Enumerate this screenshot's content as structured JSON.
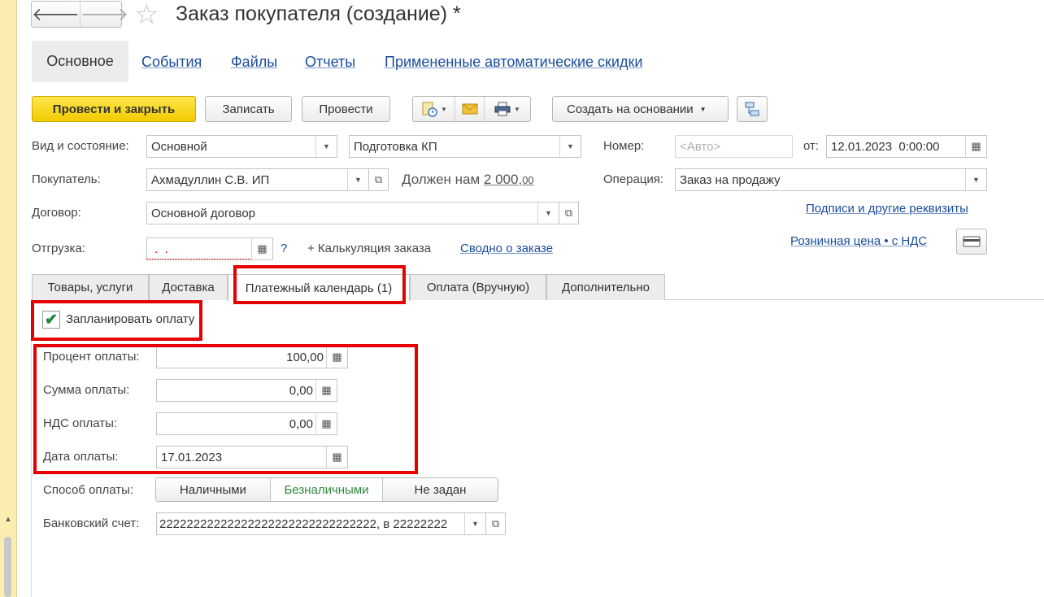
{
  "window": {
    "title": "Заказ покупателя (создание) *"
  },
  "nav": {
    "back": "🡐",
    "forward": "🡒",
    "star": "☆"
  },
  "top_tabs": {
    "main": "Основное",
    "links": [
      "События",
      "Файлы",
      "Отчеты",
      "Примененные автоматические скидки"
    ]
  },
  "toolbar": {
    "post_close": "Провести и закрыть",
    "save": "Записать",
    "post": "Провести",
    "create_based": "Создать на основании"
  },
  "form": {
    "kind_label": "Вид и состояние:",
    "kind_value": "Основной",
    "state_value": "Подготовка КП",
    "number_label": "Номер:",
    "number_placeholder": "<Авто>",
    "from_label": "от:",
    "date_value": "12.01.2023  0:00:00",
    "buyer_label": "Покупатель:",
    "buyer_value": "Ахмадуллин С.В. ИП",
    "owes_label": "Должен нам",
    "owes_amount": "2 000,",
    "owes_cents": "00",
    "operation_label": "Операция:",
    "operation_value": "Заказ на продажу",
    "contract_label": "Договор:",
    "contract_value": "Основной договор",
    "signatures_link": "Подписи и другие реквизиты",
    "shipment_label": "Отгрузка:",
    "shipment_value": " .  .",
    "question": "?",
    "calc_label": "+ Калькуляция заказа",
    "summary_link": "Сводно о заказе",
    "retail_link": "Розничная цена • с НДС"
  },
  "tabs": [
    "Товары, услуги",
    "Доставка",
    "Платежный календарь (1)",
    "Оплата (Вручную)",
    "Дополнительно"
  ],
  "payment": {
    "schedule_label": "Запланировать оплату",
    "schedule_checked": true,
    "percent_label": "Процент оплаты:",
    "percent_value": "100,00",
    "sum_label": "Сумма оплаты:",
    "sum_value": "0,00",
    "vat_label": "НДС оплаты:",
    "vat_value": "0,00",
    "date_label": "Дата оплаты:",
    "date_value": "17.01.2023",
    "method_label": "Способ оплаты:",
    "methods": [
      "Наличными",
      "Безналичными",
      "Не задан"
    ],
    "selected_method": "Безналичными",
    "bank_label": "Банковский счет:",
    "bank_value": "22222222222222222222222222222222, в 22222222"
  },
  "colors": {
    "highlight": "#e60000",
    "link": "#1a4c9c",
    "primary_button": "#f2cb00",
    "selected_method": "#2e8b3e"
  }
}
